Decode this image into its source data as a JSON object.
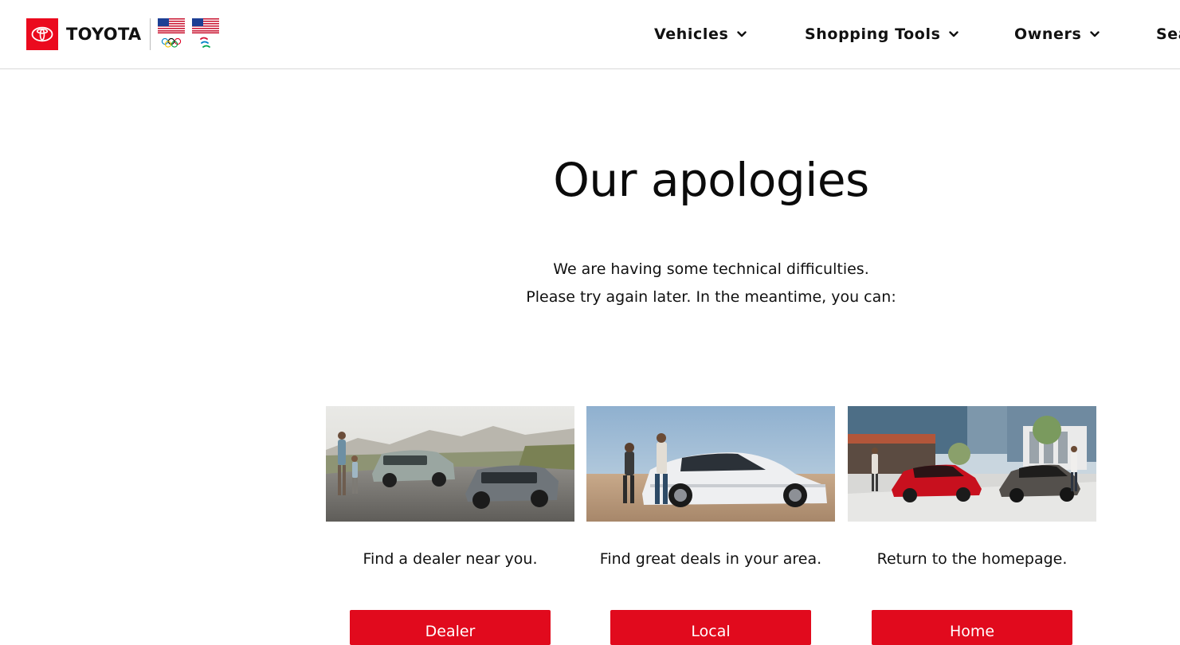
{
  "header": {
    "brand": "TOYOTA",
    "nav": [
      {
        "label": "Vehicles"
      },
      {
        "label": "Shopping Tools"
      },
      {
        "label": "Owners"
      },
      {
        "label": "Sea"
      }
    ]
  },
  "main": {
    "title": "Our apologies",
    "message_line1": "We are having some technical difficulties.",
    "message_line2": "Please try again later. In the meantime, you can:",
    "cards": [
      {
        "text": "Find a dealer near you.",
        "button": "Dealer"
      },
      {
        "text": "Find great deals in your area.",
        "button": "Local"
      },
      {
        "text": "Return to the homepage.",
        "button": "Home"
      }
    ]
  },
  "colors": {
    "brand_red": "#eb0a1e",
    "button_red": "#e10a1d"
  },
  "icons": [
    "toyota-logo-icon",
    "olympic-flag-icon",
    "paralympic-flag-icon",
    "chevron-down-icon"
  ]
}
